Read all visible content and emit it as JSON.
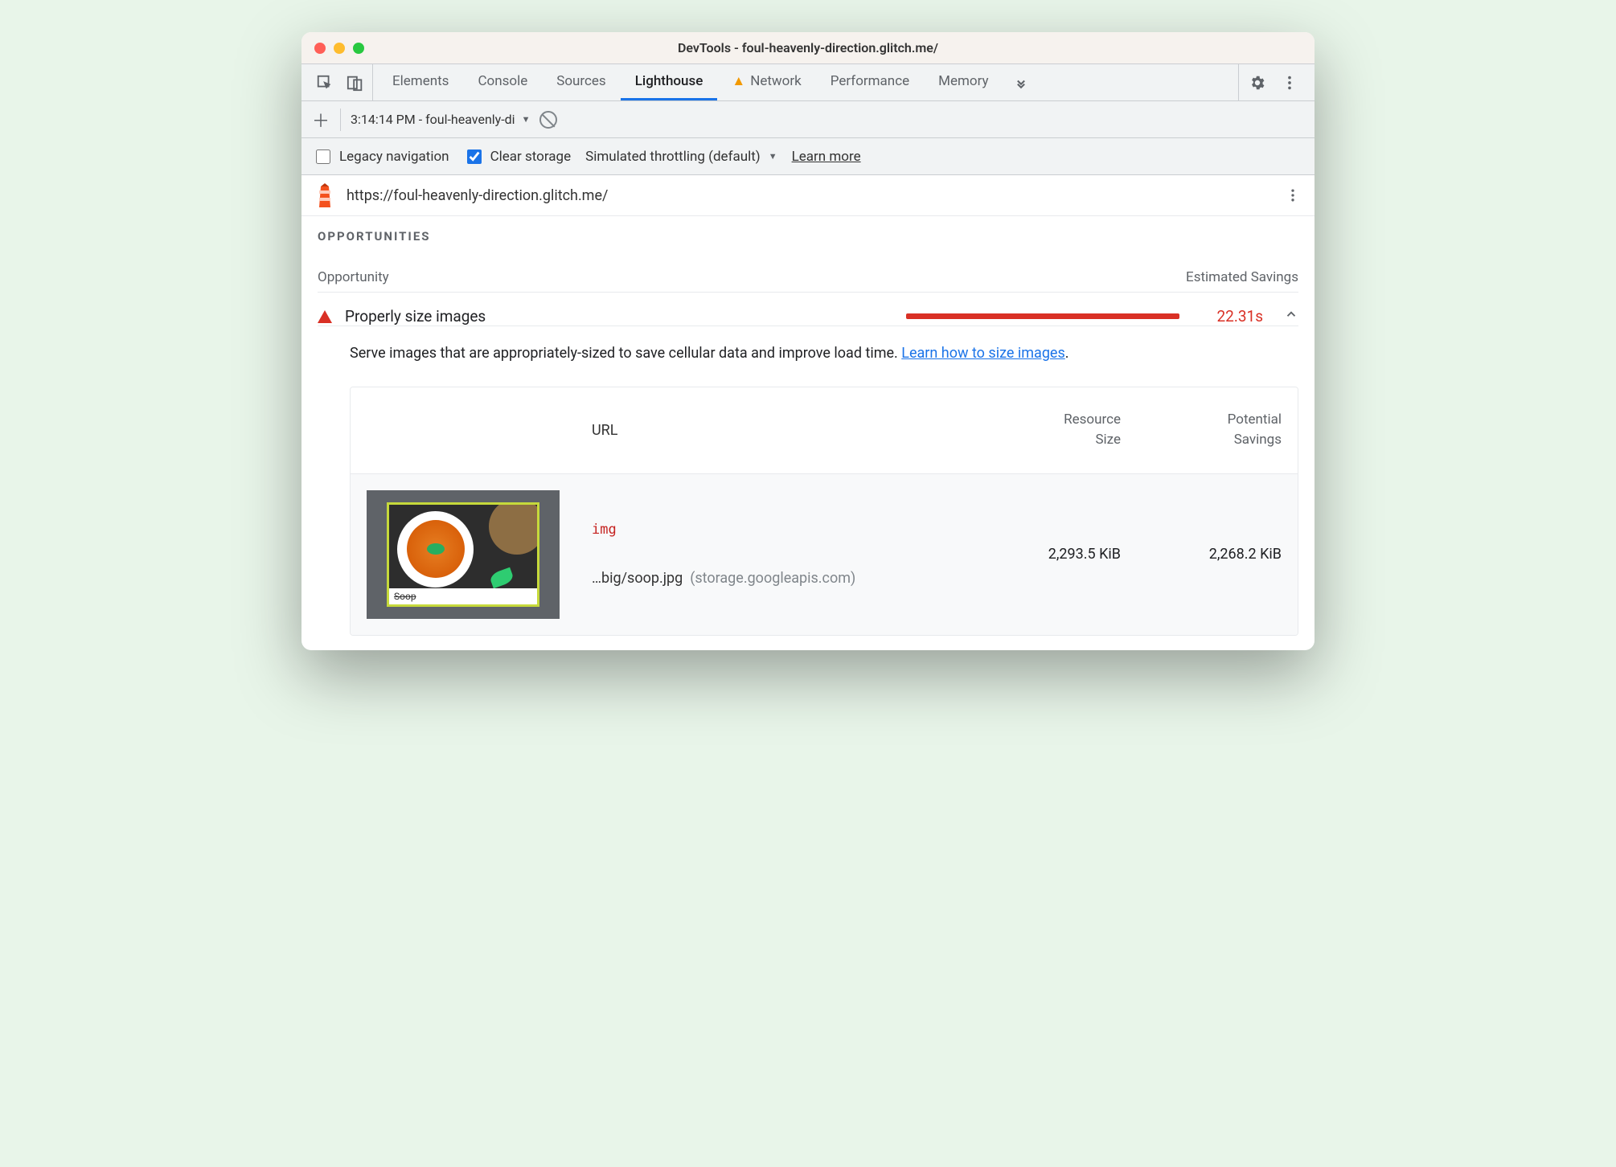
{
  "window": {
    "title": "DevTools - foul-heavenly-direction.glitch.me/"
  },
  "tabs": {
    "items": [
      "Elements",
      "Console",
      "Sources",
      "Lighthouse",
      "Network",
      "Performance",
      "Memory"
    ],
    "active_index": 3,
    "warn_index": 4
  },
  "toolbar2": {
    "run_label": "3:14:14 PM - foul-heavenly-di"
  },
  "toolbar3": {
    "legacy_label": "Legacy navigation",
    "legacy_checked": false,
    "clear_label": "Clear storage",
    "clear_checked": true,
    "throttle_label": "Simulated throttling (default)",
    "learn_more": "Learn more"
  },
  "url_row": {
    "url": "https://foul-heavenly-direction.glitch.me/"
  },
  "section": {
    "title": "OPPORTUNITIES",
    "col_opportunity": "Opportunity",
    "col_savings": "Estimated Savings"
  },
  "audit": {
    "title": "Properly size images",
    "savings": "22.31s",
    "description": "Serve images that are appropriately-sized to save cellular data and improve load time. ",
    "learn_link": "Learn how to size images"
  },
  "detail": {
    "col_url": "URL",
    "col_size_a": "Resource",
    "col_size_b": "Size",
    "col_pot_a": "Potential",
    "col_pot_b": "Savings",
    "rows": [
      {
        "tag": "img",
        "thumb_caption": "Soop",
        "path": "…big/soop.jpg",
        "host": "(storage.googleapis.com)",
        "size": "2,293.5 KiB",
        "potential": "2,268.2 KiB"
      }
    ]
  }
}
